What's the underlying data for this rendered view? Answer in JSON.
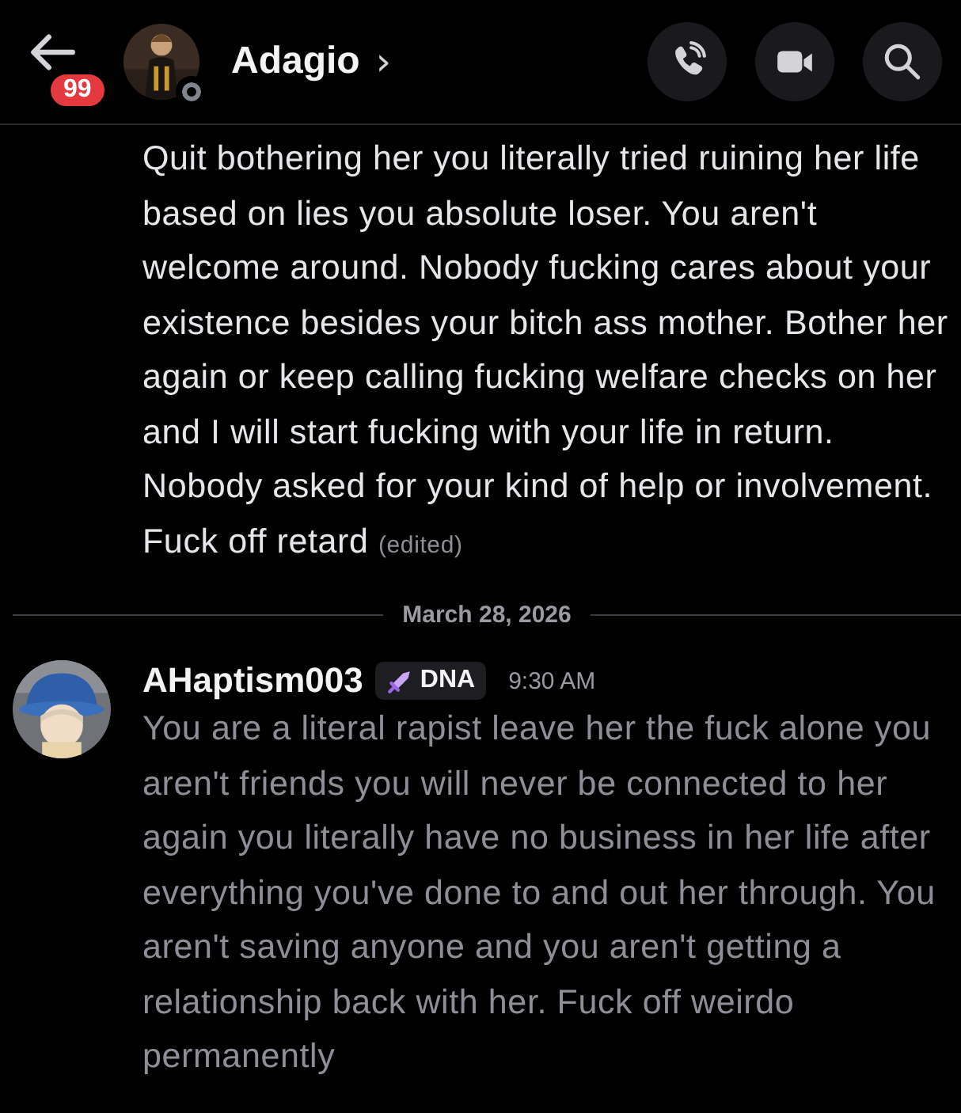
{
  "header": {
    "unread_badge": "99",
    "title": "Adagio",
    "title_chevron": "›",
    "online": false
  },
  "messages": [
    {
      "kind": "continuation",
      "text": "Quit bothering her you literally tried ruining her life based on lies you absolute loser. You aren't welcome around. Nobody fucking cares about your existence besides your bitch ass mother. Bother her again or keep calling fucking welfare checks on her and I will start fucking with your life in return. Nobody asked for your kind of help or involvement. Fuck off retard",
      "edited_label": "(edited)",
      "sending": false
    },
    {
      "kind": "divider",
      "date": "March 28, 2026"
    },
    {
      "kind": "message",
      "author": "AHaptism003",
      "tag": "DNA",
      "time": "9:30 AM",
      "text": "You are a literal rapist leave her the fuck alone you aren't friends you will never be connected to her again you literally have no business in her life after everything you've done to and out her through. You aren't saving anyone and you aren't getting a relationship back with her. Fuck off weirdo permanently",
      "sending": true
    }
  ]
}
